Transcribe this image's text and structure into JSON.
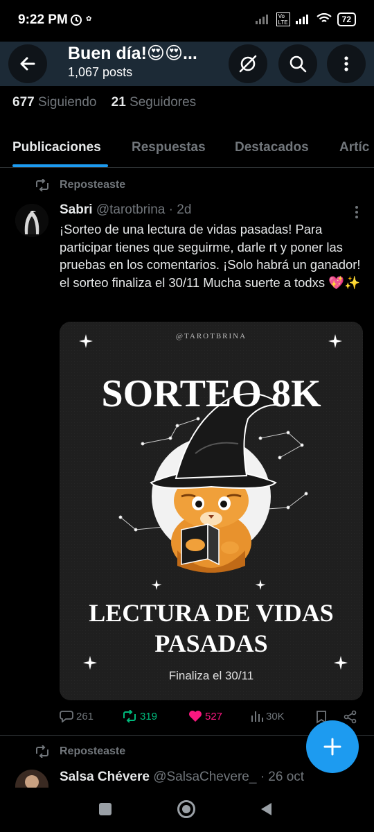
{
  "status_bar": {
    "time": "9:22 PM",
    "battery": "72"
  },
  "header": {
    "title": "Buen día!😍😍...",
    "posts": "1,067 posts"
  },
  "stats": {
    "following_count": "677",
    "following_label": "Siguiendo",
    "followers_count": "21",
    "followers_label": "Seguidores"
  },
  "tabs": [
    {
      "label": "Publicaciones"
    },
    {
      "label": "Respuestas"
    },
    {
      "label": "Destacados"
    },
    {
      "label": "Artíc"
    }
  ],
  "tweets": [
    {
      "repost_label": "Reposteaste",
      "name": "Sabri",
      "handle": "@tarotbrina",
      "time": "· 2d",
      "text": "¡Sorteo de una lectura de vidas pasadas! Para participar tienes que seguirme, darle rt y poner las pruebas en los comentarios. ¡Solo habrá un ganador! el sorteo finaliza el 30/11 Mucha suerte a todxs 💖✨",
      "media": {
        "watermark": "@TAROTBRINA",
        "headline": "SORTEO 8K",
        "subtitle_line1": "LECTURA DE VIDAS",
        "subtitle_line2": "PASADAS",
        "footer": "Finaliza el 30/11"
      },
      "stats": {
        "replies": "261",
        "reposts": "319",
        "likes": "527",
        "views": "30K"
      }
    },
    {
      "repost_label": "Reposteaste",
      "name": "Salsa Chévere",
      "handle": "@SalsaChevere_",
      "time": "· 26 oct"
    }
  ],
  "colors": {
    "accent": "#1d9bf0",
    "header_bg": "#1c2a36",
    "repost_green": "#00ba7c",
    "like_pink": "#f91880"
  }
}
